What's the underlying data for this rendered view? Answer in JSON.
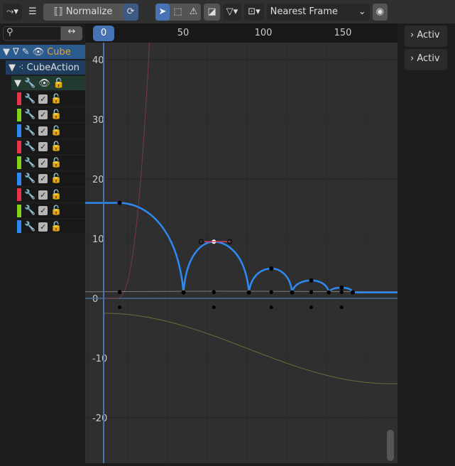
{
  "header": {
    "normalize_label": "Normalize",
    "snap_mode": "Nearest Frame"
  },
  "search": {
    "value": "",
    "swap_icon": "↔"
  },
  "channels": {
    "object": "Cube",
    "action": "CubeAction",
    "fcurve_colors": [
      "#e8344b",
      "#7fd41b",
      "#2e8af2",
      "#e8344b",
      "#7fd41b",
      "#2e8af2",
      "#e8344b",
      "#7fd41b",
      "#2e8af2"
    ]
  },
  "ruler": {
    "current_frame": "0",
    "labels": [
      "50",
      "100",
      "150"
    ]
  },
  "yaxis": {
    "labels": [
      "40",
      "30",
      "20",
      "10",
      "0",
      "-10",
      "-20"
    ]
  },
  "sidebar": {
    "tabs": [
      "Activ",
      "Activ"
    ]
  },
  "curves": {
    "blue_keys": [
      [
        -20,
        16
      ],
      [
        10,
        16
      ],
      [
        50,
        1
      ],
      [
        69,
        9.5
      ],
      [
        91,
        1
      ],
      [
        105,
        5
      ],
      [
        118,
        1
      ],
      [
        130,
        3
      ],
      [
        141,
        1
      ],
      [
        149,
        1.8
      ],
      [
        156,
        1
      ],
      [
        190,
        1
      ]
    ],
    "colors": {
      "blue": "#2e8af2",
      "red": "#7a3a40",
      "olive": "#6b6b3a",
      "gray": "#7a7a7a"
    }
  }
}
